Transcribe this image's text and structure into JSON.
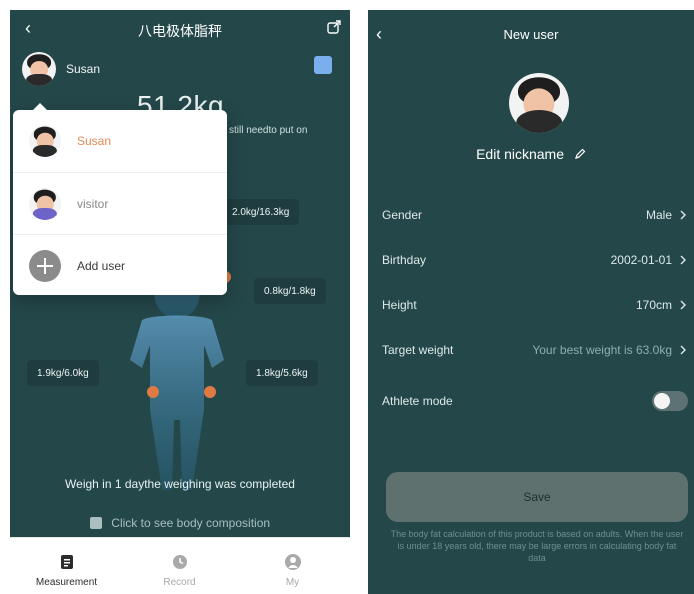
{
  "left": {
    "title": "八电极体脂秤",
    "current_user": "Susan",
    "weight_display": "51.2kg",
    "note": "still needto put on",
    "metrics": {
      "m1": "2.0kg/16.3kg",
      "m2": "0.8kg/1.8kg",
      "m3": "1.9kg/6.0kg",
      "m4": "1.8kg/5.6kg"
    },
    "dropdown": {
      "items": [
        {
          "label": "Susan"
        },
        {
          "label": "visitor"
        },
        {
          "label": "Add user"
        }
      ]
    },
    "status": {
      "weigh_line": "Weigh in 1 daythe weighing was completed",
      "click_line": "Click to see body composition"
    },
    "tabs": [
      {
        "label": "Measurement"
      },
      {
        "label": "Record"
      },
      {
        "label": "My"
      }
    ],
    "icons": {
      "back": "chevron-left-icon",
      "share": "share-icon",
      "bluetooth": "bluetooth-icon",
      "hand": "hand-tap-icon",
      "tab_measurement": "document-icon",
      "tab_record": "clock-icon",
      "tab_my": "user-icon"
    },
    "colors": {
      "panel_bg": "#24474a",
      "dropdown_active": "#e48a55",
      "badge_blue": "#7fb5f6"
    }
  },
  "right": {
    "title": "New user",
    "nickname_label": "Edit nickname",
    "rows": [
      {
        "label": "Gender",
        "value": "Male"
      },
      {
        "label": "Birthday",
        "value": "2002-01-01"
      },
      {
        "label": "Height",
        "value": "170cm"
      },
      {
        "label": "Target weight",
        "value": "Your best weight is 63.0kg"
      },
      {
        "label": "Athlete mode",
        "value": ""
      }
    ],
    "save_label": "Save",
    "disclaimer": "The body fat calculation of this product is based on adults. When the user is under 18 years old, there may be large errors in calculating body fat data",
    "icons": {
      "back": "chevron-left-icon",
      "edit": "pencil-icon",
      "chevron": "chevron-right-icon",
      "toggle": "toggle-off-icon"
    }
  }
}
